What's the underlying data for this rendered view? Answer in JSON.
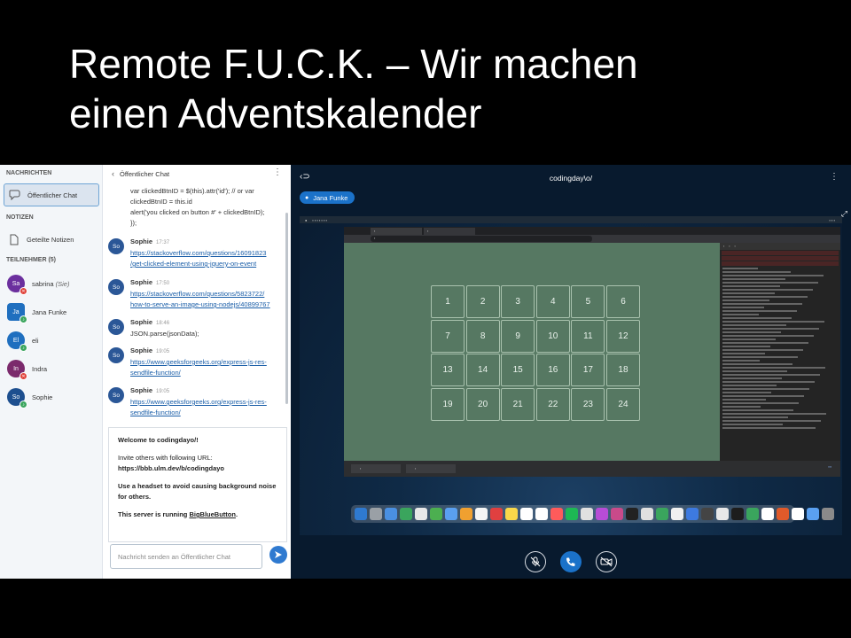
{
  "slide": {
    "title_line1": "Remote F.U.C.K. – Wir machen",
    "title_line2": "einen Adventskalender"
  },
  "sidebar": {
    "messages_header": "NACHRICHTEN",
    "public_chat": "Öffentlicher Chat",
    "notes_header": "NOTIZEN",
    "shared_notes": "Geteilte Notizen",
    "participants_header": "TEILNEHMER (5)",
    "you_suffix": "(Sie)",
    "users": [
      {
        "initials": "Sa",
        "name": "sabrina",
        "color": "#6b2f9e",
        "badge_color": "#e0443c",
        "is_you": true
      },
      {
        "initials": "Ja",
        "name": "Jana Funke",
        "color": "#1f6fbf",
        "badge_color": "#3aa55d",
        "moderator": true
      },
      {
        "initials": "El",
        "name": "eli",
        "color": "#1f6fbf",
        "badge_color": "#3aa55d"
      },
      {
        "initials": "In",
        "name": "Indra",
        "color": "#7b2a6c",
        "badge_color": "#e0443c"
      },
      {
        "initials": "So",
        "name": "Sophie",
        "color": "#1d4f8f",
        "badge_color": "#3aa55d"
      }
    ]
  },
  "chat": {
    "title": "Öffentlicher Chat",
    "code_lines": [
      "var clickedBtnID = $(this).attr('id'); // or var",
      "clickedBtnID = this.id",
      "alert('you clicked on button #' + clickedBtnID);",
      "});"
    ],
    "messages": [
      {
        "initials": "So",
        "name": "Sophie",
        "time": "17:37",
        "lines": [
          "https://stackoverflow.com/questions/16091823",
          "/get-clicked-element-using-jquery-on-event"
        ],
        "is_link": true
      },
      {
        "initials": "So",
        "name": "Sophie",
        "time": "17:50",
        "lines": [
          "https://stackoverflow.com/questions/5823722/",
          "how-to-serve-an-image-using-nodejs/40899767"
        ],
        "is_link": true
      },
      {
        "initials": "So",
        "name": "Sophie",
        "time": "18:46",
        "lines": [
          "JSON.parse(jsonData);"
        ],
        "is_link": false
      },
      {
        "initials": "So",
        "name": "Sophie",
        "time": "19:05",
        "lines": [
          "https://www.geeksforgeeks.org/express-js-res-",
          "sendfile-function/"
        ],
        "is_link": true
      },
      {
        "initials": "So",
        "name": "Sophie",
        "time": "19:05",
        "lines": [
          "https://www.geeksforgeeks.org/express-js-res-",
          "sendfile-function/"
        ],
        "is_link": true
      }
    ],
    "welcome": {
      "title_prefix": "Welcome to ",
      "room": "codingdayo",
      "title_suffix": "/!",
      "invite": "Invite others with following URL:",
      "url": "https://bbb.ulm.dev/b/codingdayo",
      "headset": "Use a headset to avoid causing background noise for others.",
      "server_prefix": "This server is running ",
      "server_link": "BigBlueButton",
      "server_suffix": "."
    },
    "input_placeholder": "Nachricht senden an Öffentlicher Chat"
  },
  "stage": {
    "room_name": "codingday\\o/",
    "talker": "Jana Funke",
    "calendar_days": [
      "1",
      "2",
      "3",
      "4",
      "5",
      "6",
      "7",
      "8",
      "9",
      "10",
      "11",
      "12",
      "13",
      "14",
      "15",
      "16",
      "17",
      "18",
      "19",
      "20",
      "21",
      "22",
      "23",
      "24"
    ]
  },
  "icons": {
    "back": "chevron-left-icon",
    "kebab": "kebab-icon",
    "send": "send-icon",
    "mic": "microphone-icon",
    "phone": "phone-icon",
    "camera": "camera-icon"
  },
  "colors": {
    "accent": "#1b72c9",
    "page_green": "#567862",
    "stage_bg": "#081a2e"
  }
}
